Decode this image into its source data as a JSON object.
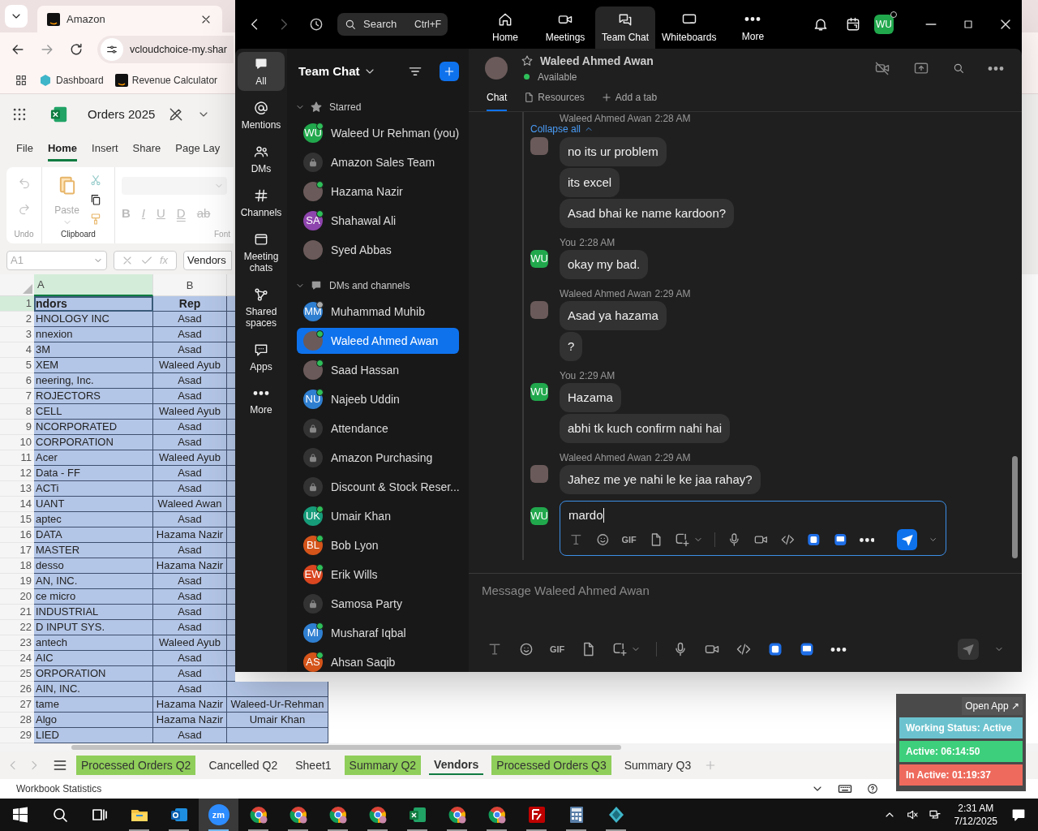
{
  "browser": {
    "tab_title": "Amazon",
    "url": "vcloudchoice-my.shar",
    "bookmarks": [
      "Dashboard",
      "Revenue Calculator"
    ]
  },
  "excel": {
    "file_name": "Orders 2025",
    "ribbon_tabs": [
      {
        "label": "File",
        "selected": false
      },
      {
        "label": "Home",
        "selected": true
      },
      {
        "label": "Insert",
        "selected": false
      },
      {
        "label": "Share",
        "selected": false
      },
      {
        "label": "Page Lay",
        "selected": false
      }
    ],
    "paste_label": "Paste",
    "group_labels": [
      "Undo",
      "Clipboard",
      "Font"
    ],
    "font_buttons": [
      {
        "label": "B",
        "kind": "bold"
      },
      {
        "label": "I",
        "kind": "italic"
      },
      {
        "label": "U",
        "kind": "underline"
      },
      {
        "label": "D",
        "kind": "double"
      },
      {
        "label": "ab",
        "kind": "strike"
      }
    ],
    "name_box": "A1",
    "fx": "fx",
    "formula": "Vendors",
    "column_headers": [
      {
        "label": "A",
        "selected": true
      },
      {
        "label": "B",
        "selected": false
      }
    ],
    "rows": [
      {
        "num": "1",
        "a": "ndors",
        "b": "Rep",
        "c": "",
        "selected": true
      },
      {
        "num": "2",
        "a": "HNOLOGY INC",
        "b": "Asad",
        "c": "",
        "selected": false
      },
      {
        "num": "3",
        "a": "nnexion",
        "b": "Asad",
        "c": "",
        "selected": false
      },
      {
        "num": "4",
        "a": "3M",
        "b": "Asad",
        "c": "",
        "selected": false
      },
      {
        "num": "5",
        "a": "XEM",
        "b": "Waleed Ayub",
        "c": "",
        "selected": false
      },
      {
        "num": "6",
        "a": "neering, Inc.",
        "b": "Asad",
        "c": "",
        "selected": false
      },
      {
        "num": "7",
        "a": "ROJECTORS",
        "b": "Asad",
        "c": "",
        "selected": false
      },
      {
        "num": "8",
        "a": "CELL",
        "b": "Waleed Ayub",
        "c": "",
        "selected": false
      },
      {
        "num": "9",
        "a": "NCORPORATED",
        "b": "Asad",
        "c": "",
        "selected": false
      },
      {
        "num": "10",
        "a": "CORPORATION",
        "b": "Asad",
        "c": "",
        "selected": false
      },
      {
        "num": "11",
        "a": "Acer",
        "b": "Waleed Ayub",
        "c": "",
        "selected": false
      },
      {
        "num": "12",
        "a": "Data - FF",
        "b": "Asad",
        "c": "",
        "selected": false
      },
      {
        "num": "13",
        "a": "ACTi",
        "b": "Asad",
        "c": "",
        "selected": false
      },
      {
        "num": "14",
        "a": "UANT",
        "b": "Waleed Awan",
        "c": "",
        "selected": false
      },
      {
        "num": "15",
        "a": "aptec",
        "b": "Asad",
        "c": "",
        "selected": false
      },
      {
        "num": "16",
        "a": "DATA",
        "b": "Hazama Nazir",
        "c": "",
        "selected": false
      },
      {
        "num": "17",
        "a": "MASTER",
        "b": "Asad",
        "c": "",
        "selected": false
      },
      {
        "num": "18",
        "a": "desso",
        "b": "Hazama Nazir",
        "c": "",
        "selected": false
      },
      {
        "num": "19",
        "a": "AN, INC.",
        "b": "Asad",
        "c": "",
        "selected": false
      },
      {
        "num": "20",
        "a": "ce micro",
        "b": "Asad",
        "c": "",
        "selected": false
      },
      {
        "num": "21",
        "a": "INDUSTRIAL",
        "b": "Asad",
        "c": "",
        "selected": false
      },
      {
        "num": "22",
        "a": "D INPUT SYS.",
        "b": "Asad",
        "c": "",
        "selected": false
      },
      {
        "num": "23",
        "a": "antech",
        "b": "Waleed Ayub",
        "c": "",
        "selected": false
      },
      {
        "num": "24",
        "a": "AIC",
        "b": "Asad",
        "c": "",
        "selected": false
      },
      {
        "num": "25",
        "a": "ORPORATION",
        "b": "Asad",
        "c": "",
        "selected": false
      },
      {
        "num": "26",
        "a": "AIN, INC.",
        "b": "Asad",
        "c": "",
        "selected": false
      },
      {
        "num": "27",
        "a": "tame",
        "b": "Hazama Nazir",
        "c": "Waleed-Ur-Rehman",
        "selected": false
      },
      {
        "num": "28",
        "a": "Algo",
        "b": "Hazama Nazir",
        "c": "Umair Khan",
        "selected": false
      },
      {
        "num": "29",
        "a": "LIED",
        "b": "Asad",
        "c": "",
        "selected": false
      }
    ],
    "sheet_tabs": [
      {
        "label": "Processed Orders Q2",
        "highlighted": true,
        "selected": false
      },
      {
        "label": "Cancelled Q2",
        "highlighted": false,
        "selected": false
      },
      {
        "label": "Sheet1",
        "highlighted": false,
        "selected": false
      },
      {
        "label": "Summary Q2",
        "highlighted": true,
        "selected": false
      },
      {
        "label": "Vendors",
        "highlighted": false,
        "selected": true
      },
      {
        "label": "Processed Orders Q3",
        "highlighted": true,
        "selected": false
      },
      {
        "label": "Summary Q3",
        "highlighted": false,
        "selected": false
      }
    ],
    "status_text": "Workbook Statistics"
  },
  "zoom": {
    "search": {
      "placeholder": "Search",
      "shortcut": "Ctrl+F"
    },
    "nav_tabs": [
      {
        "label": "Home",
        "kind": "home",
        "selected": false
      },
      {
        "label": "Meetings",
        "kind": "meetings",
        "selected": false
      },
      {
        "label": "Team Chat",
        "kind": "chat",
        "selected": true
      },
      {
        "label": "Whiteboards",
        "kind": "whiteboard",
        "selected": false
      },
      {
        "label": "More",
        "kind": "more",
        "selected": false
      }
    ],
    "user_initials": "WU",
    "rail": [
      {
        "label": "All",
        "kind": "all",
        "selected": true
      },
      {
        "label": "Mentions",
        "kind": "mentions",
        "selected": false
      },
      {
        "label": "DMs",
        "kind": "dms",
        "selected": false
      },
      {
        "label": "Channels",
        "kind": "channels",
        "selected": false
      },
      {
        "label": "Meeting chats",
        "kind": "meeting",
        "selected": false
      },
      {
        "label": "Shared spaces",
        "kind": "shared",
        "selected": false
      },
      {
        "label": "Apps",
        "kind": "apps",
        "selected": false
      },
      {
        "label": "More",
        "kind": "more",
        "selected": false
      }
    ],
    "list_title": "Team Chat",
    "sections": [
      {
        "title": "Starred",
        "kind": "star",
        "expanded": true,
        "items": [
          {
            "name": "Waleed Ur Rehman (you)",
            "kind": "initials",
            "initials": "WU",
            "color": "#21a84d",
            "online": true,
            "away": false,
            "selected": false
          },
          {
            "name": "Amazon Sales Team",
            "kind": "channel",
            "online": false,
            "away": false,
            "selected": false
          },
          {
            "name": "Hazama Nazir",
            "kind": "photo",
            "online": true,
            "away": false,
            "selected": false
          },
          {
            "name": "Shahawal Ali",
            "kind": "initials",
            "initials": "SA",
            "color": "#8e44ad",
            "online": true,
            "away": false,
            "selected": false
          },
          {
            "name": "Syed Abbas",
            "kind": "photo",
            "online": false,
            "away": false,
            "selected": false
          }
        ]
      },
      {
        "title": "DMs and channels",
        "kind": "bubble",
        "expanded": true,
        "items": [
          {
            "name": "Muhammad Muhib",
            "kind": "initials",
            "initials": "MM",
            "color": "#2f7fd1",
            "online": false,
            "away": true,
            "selected": false
          },
          {
            "name": "Waleed Ahmed Awan",
            "kind": "photo",
            "online": true,
            "away": false,
            "selected": true
          },
          {
            "name": "Saad Hassan",
            "kind": "photo",
            "online": true,
            "away": false,
            "selected": false
          },
          {
            "name": "Najeeb Uddin",
            "kind": "initials",
            "initials": "NU",
            "color": "#2f7fd1",
            "online": true,
            "away": false,
            "selected": false
          },
          {
            "name": "Attendance",
            "kind": "channel",
            "online": false,
            "away": false,
            "selected": false
          },
          {
            "name": "Amazon Purchasing",
            "kind": "channel",
            "online": false,
            "away": false,
            "selected": false
          },
          {
            "name": "Discount & Stock Reser...",
            "kind": "channel",
            "online": false,
            "away": false,
            "selected": false
          },
          {
            "name": "Umair Khan",
            "kind": "initials",
            "initials": "UK",
            "color": "#179c7a",
            "online": true,
            "away": false,
            "selected": false
          },
          {
            "name": "Bob Lyon",
            "kind": "initials",
            "initials": "BL",
            "color": "#d4541a",
            "online": true,
            "away": false,
            "selected": false
          },
          {
            "name": "Erik Wills",
            "kind": "initials",
            "initials": "EW",
            "color": "#d9461f",
            "online": true,
            "away": false,
            "selected": false
          },
          {
            "name": "Samosa Party",
            "kind": "channel",
            "online": false,
            "away": false,
            "selected": false
          },
          {
            "name": "Musharaf Iqbal",
            "kind": "initials",
            "initials": "MI",
            "color": "#2f7fd1",
            "online": true,
            "away": false,
            "selected": false
          },
          {
            "name": "Ahsan Saqib",
            "kind": "initials",
            "initials": "AS",
            "color": "#d4541a",
            "online": true,
            "away": false,
            "selected": false
          }
        ]
      }
    ],
    "chat": {
      "name": "Waleed Ahmed Awan",
      "status": "Available",
      "tabs": [
        {
          "label": "Chat",
          "kind": "chat",
          "selected": true
        },
        {
          "label": "Resources",
          "kind": "files",
          "selected": false
        },
        {
          "label": "Add a tab",
          "kind": "add",
          "selected": false
        }
      ],
      "collapse_label": "Collapse all",
      "groups": [
        {
          "sender": "Waleed Ahmed Awan",
          "time": "2:28 AM",
          "kind": "photo",
          "messages": [
            "no its ur problem",
            "its excel",
            "Asad bhai ke name kardoon?"
          ]
        },
        {
          "sender": "You",
          "time": "2:28 AM",
          "kind": "initials",
          "initials": "WU",
          "messages": [
            "okay my bad."
          ]
        },
        {
          "sender": "Waleed Ahmed Awan",
          "time": "2:29 AM",
          "kind": "photo",
          "messages": [
            "Asad ya hazama",
            "?"
          ]
        },
        {
          "sender": "You",
          "time": "2:29 AM",
          "kind": "initials",
          "initials": "WU",
          "messages": [
            "Hazama",
            "abhi tk kuch confirm nahi hai"
          ]
        },
        {
          "sender": "Waleed Ahmed Awan",
          "time": "2:29 AM",
          "kind": "photo",
          "messages": [
            "Jahez me ye nahi le ke jaa rahay?"
          ]
        }
      ],
      "reply": {
        "initials": "WU",
        "value": "mardo",
        "gif_label": "GIF",
        "send_enabled": true
      },
      "composer": {
        "placeholder": "Message Waleed Ahmed Awan",
        "gif_label": "GIF",
        "send_enabled": false
      }
    }
  },
  "widget": {
    "open_app": "Open App ↗",
    "statuses": [
      {
        "text": "Working Status: Active",
        "color": "#6cc3cf"
      },
      {
        "text": "Active: 06:14:50",
        "color": "#3ecf7c"
      },
      {
        "text": "In Active: 01:19:37",
        "color": "#ee6a5c"
      }
    ]
  },
  "taskbar": {
    "apps": [
      {
        "kind": "start",
        "running": false,
        "active": false
      },
      {
        "kind": "search",
        "running": false,
        "active": false
      },
      {
        "kind": "taskview",
        "running": false,
        "active": false
      },
      {
        "kind": "folder",
        "running": true,
        "active": false
      },
      {
        "kind": "mail",
        "running": true,
        "active": false
      },
      {
        "kind": "zoom",
        "label": "zm",
        "running": true,
        "active": true
      },
      {
        "kind": "browser",
        "running": true,
        "active": false
      },
      {
        "kind": "browser",
        "running": true,
        "active": false
      },
      {
        "kind": "browser",
        "running": true,
        "active": false
      },
      {
        "kind": "browser",
        "running": true,
        "active": false
      },
      {
        "kind": "sheet",
        "running": true,
        "active": false
      },
      {
        "kind": "browser",
        "running": true,
        "active": false
      },
      {
        "kind": "browser",
        "running": true,
        "active": false
      },
      {
        "kind": "ftp",
        "running": true,
        "active": false
      },
      {
        "kind": "calculator",
        "running": true,
        "active": false
      },
      {
        "kind": "diamond",
        "running": true,
        "active": false
      }
    ],
    "time": "2:31 AM",
    "date": "7/12/2025"
  }
}
